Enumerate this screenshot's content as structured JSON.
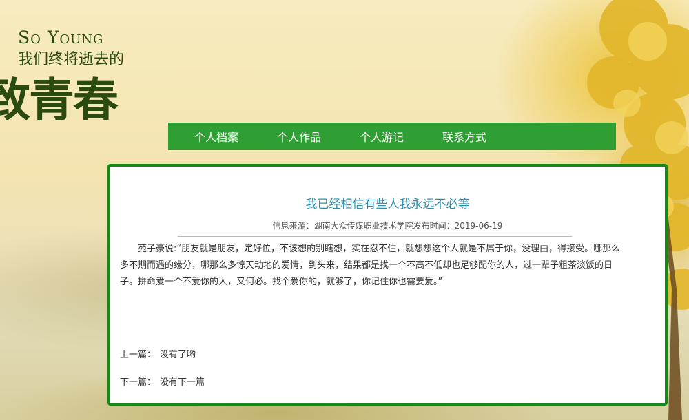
{
  "banner": {
    "en_first": "S",
    "en_first_rest": "O",
    "en_second": "Y",
    "en_second_rest": "OUNG",
    "subtitle": "我们终将逝去的",
    "main": "致青春"
  },
  "nav": {
    "items": [
      {
        "label": "个人档案"
      },
      {
        "label": "个人作品"
      },
      {
        "label": "个人游记"
      },
      {
        "label": "联系方式"
      }
    ]
  },
  "article": {
    "title": "我已经相信有些人我永远不必等",
    "meta": "信息来源：湖南大众传媒职业技术学院发布时间：2019-06-19",
    "body": "苑子豪说:“朋友就是朋友，定好位，不该想的别瞎想，实在忍不住，就想想这个人就是不属于你，没理由，得接受。哪那么多不期而遇的缘分，哪那么多惊天动地的爱情，到头来，结果都是找一个不高不低却也足够配你的人，过一辈子粗茶淡饭的日子。拼命爱一个不爱你的人，又何必。找个爱你的，就够了，你记住你也需要爱。”",
    "prev_label": "上一篇：",
    "prev_value": "没有了哟",
    "next_label": "下一篇：",
    "next_value": "没有下一篇"
  },
  "colors": {
    "nav_bg": "#2f9e33",
    "article_border": "#158a14",
    "title": "#2a8fb0"
  }
}
